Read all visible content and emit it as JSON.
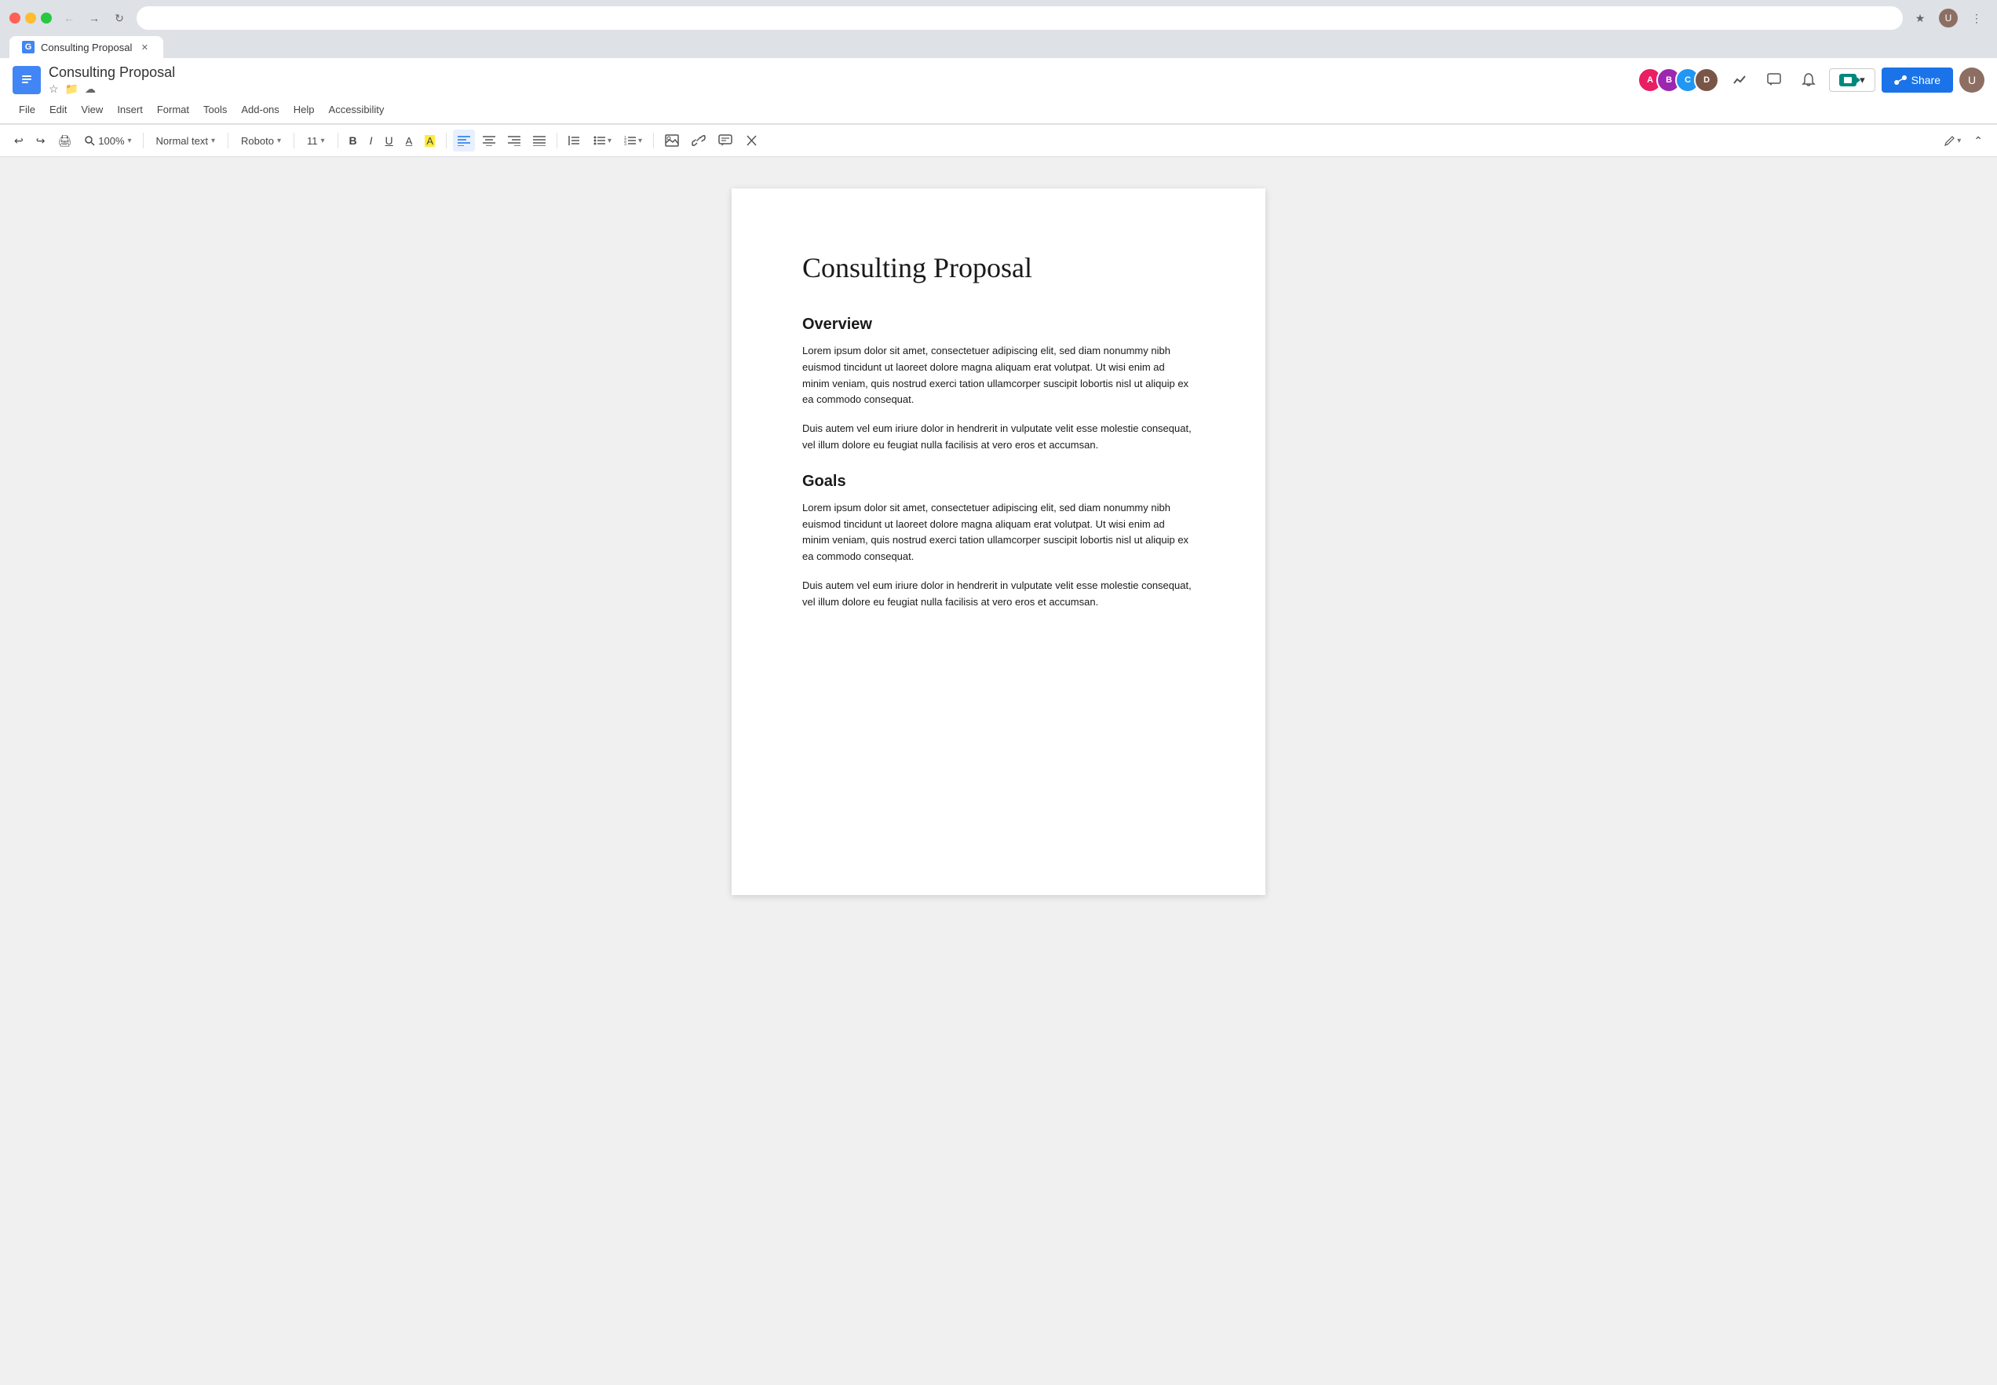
{
  "browser": {
    "tab_title": "Consulting Proposal",
    "tab_icon": "G",
    "address_bar_text": ""
  },
  "docs": {
    "title": "Consulting Proposal",
    "logo_char": "≡",
    "menu_items": [
      "File",
      "Edit",
      "View",
      "Insert",
      "Format",
      "Tools",
      "Add-ons",
      "Help",
      "Accessibility"
    ],
    "share_label": "Share",
    "toolbar": {
      "undo_label": "↩",
      "redo_label": "↪",
      "print_label": "🖨",
      "zoom_value": "100%",
      "style_label": "Normal text",
      "font_label": "Roboto",
      "size_label": "11",
      "bold_label": "B",
      "italic_label": "I",
      "underline_label": "U",
      "textcolor_label": "A",
      "highlight_label": "A"
    },
    "collaborators": [
      {
        "initials": "A",
        "color": "#e91e63"
      },
      {
        "initials": "B",
        "color": "#9c27b0"
      },
      {
        "initials": "C",
        "color": "#2196f3"
      },
      {
        "initials": "D",
        "color": "#795548"
      }
    ]
  },
  "document": {
    "title": "Consulting Proposal",
    "sections": [
      {
        "heading": "Overview",
        "paragraphs": [
          "Lorem ipsum dolor sit amet, consectetuer adipiscing elit, sed diam nonummy nibh euismod tincidunt ut laoreet dolore magna aliquam erat volutpat. Ut wisi enim ad minim veniam, quis nostrud exerci tation ullamcorper suscipit lobortis nisl ut aliquip ex ea commodo consequat.",
          "Duis autem vel eum iriure dolor in hendrerit in vulputate velit esse molestie consequat, vel illum dolore eu feugiat nulla facilisis at vero eros et accumsan."
        ]
      },
      {
        "heading": "Goals",
        "paragraphs": [
          "Lorem ipsum dolor sit amet, consectetuer adipiscing elit, sed diam nonummy nibh euismod tincidunt ut laoreet dolore magna aliquam erat volutpat. Ut wisi enim ad minim veniam, quis nostrud exerci tation ullamcorper suscipit lobortis nisl ut aliquip ex ea commodo consequat.",
          "Duis autem vel eum iriure dolor in hendrerit in vulputate velit esse molestie consequat, vel illum dolore eu feugiat nulla facilisis at vero eros et accumsan."
        ]
      }
    ]
  }
}
